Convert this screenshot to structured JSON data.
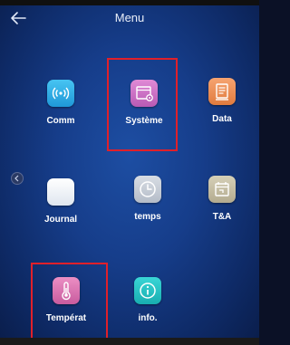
{
  "header": {
    "title": "Menu",
    "back_icon": "arrow-left-icon"
  },
  "apps": [
    {
      "label": "Comm",
      "icon": "wireless-signal-icon",
      "color": "#33b3e8"
    },
    {
      "label": "Système",
      "icon": "window-settings-icon",
      "color": "#d070c8"
    },
    {
      "label": "Data",
      "icon": "document-icon",
      "color": "#f0925a"
    },
    {
      "label": "Journal",
      "icon": "blank-tile-icon",
      "color": "#e8eef6"
    },
    {
      "label": "temps",
      "icon": "clock-icon",
      "color": "#c9cfd8"
    },
    {
      "label": "T&A",
      "icon": "calendar-icon",
      "color": "#c8c2ac"
    },
    {
      "label": "Températ",
      "icon": "thermometer-icon",
      "color": "#e078b4"
    },
    {
      "label": "info.",
      "icon": "info-icon",
      "color": "#27c4c6"
    }
  ],
  "highlight_color": "#e0202a",
  "pager_icon": "chevron-left-icon"
}
